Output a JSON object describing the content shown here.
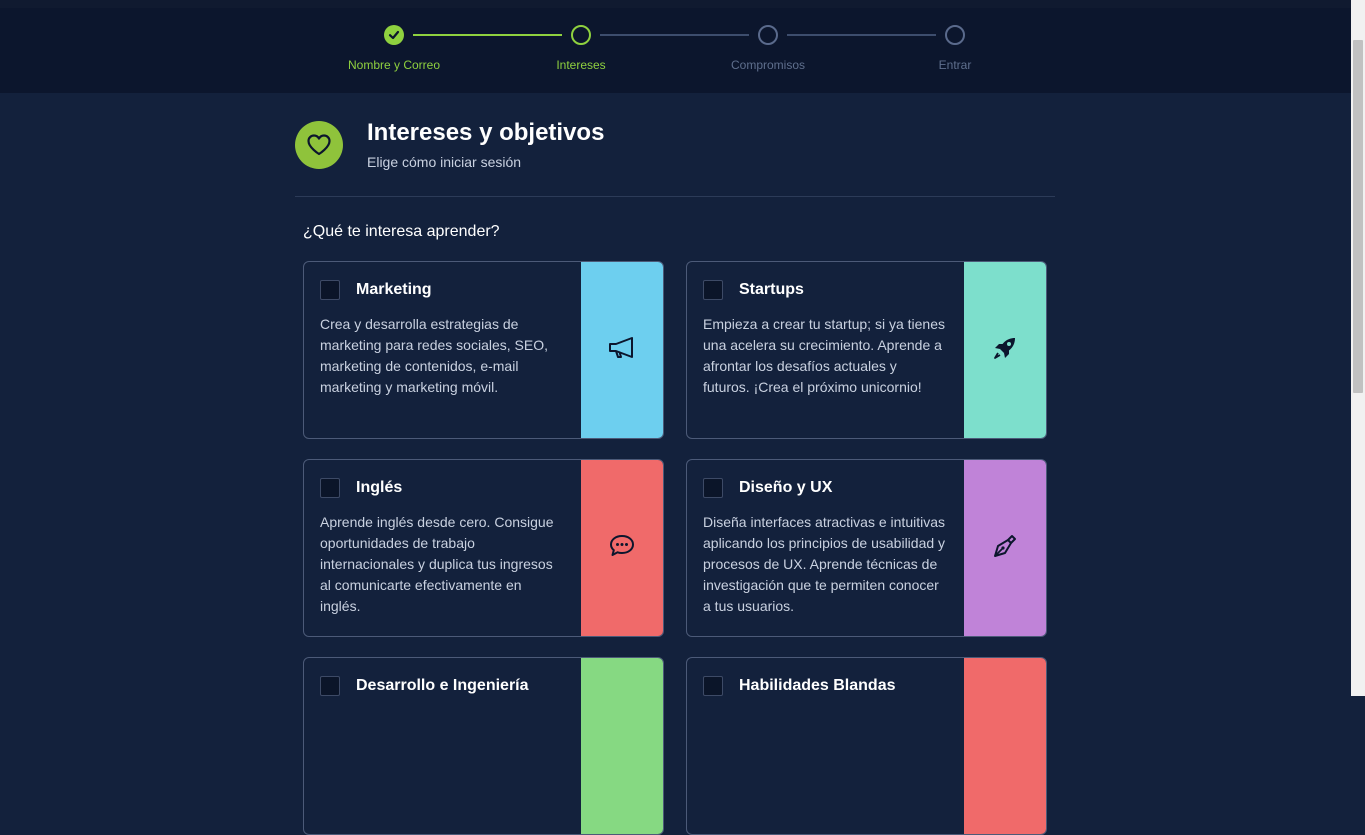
{
  "stepper": {
    "steps": [
      {
        "label": "Nombre y Correo",
        "state": "done"
      },
      {
        "label": "Intereses",
        "state": "current"
      },
      {
        "label": "Compromisos",
        "state": "todo"
      },
      {
        "label": "Entrar",
        "state": "todo"
      }
    ]
  },
  "header": {
    "title": "Intereses y objetivos",
    "subtitle": "Elige cómo iniciar sesión",
    "icon": "heart-icon"
  },
  "question": "¿Qué te interesa aprender?",
  "cards": [
    {
      "title": "Marketing",
      "description": "Crea y desarrolla estrategias de marketing para redes sociales, SEO, marketing de contenidos, e-mail marketing y marketing móvil.",
      "icon": "megaphone-icon",
      "color": "#6dcfef",
      "checked": false
    },
    {
      "title": "Startups",
      "description": "Empieza a crear tu startup; si ya tienes una acelera su crecimiento. Aprende a afrontar los desafíos actuales y futuros. ¡Crea el próximo unicornio!",
      "icon": "rocket-icon",
      "color": "#7ddfcc",
      "checked": false
    },
    {
      "title": "Inglés",
      "description": "Aprende inglés desde cero. Consigue oportunidades de trabajo internacionales y duplica tus ingresos al comunicarte efectivamente en inglés.",
      "icon": "chat-bubble-icon",
      "color": "#f06a6a",
      "checked": false
    },
    {
      "title": "Diseño y UX",
      "description": "Diseña interfaces atractivas e intuitivas aplicando los principios de usabilidad y procesos de UX. Aprende técnicas de investigación que te permiten conocer a tus usuarios.",
      "icon": "pen-nib-icon",
      "color": "#c083d8",
      "checked": false
    },
    {
      "title": "Desarrollo e Ingeniería",
      "description": "",
      "icon": "",
      "color": "#86d982",
      "checked": false
    },
    {
      "title": "Habilidades Blandas",
      "description": "",
      "icon": "",
      "color": "#f06a6a",
      "checked": false
    }
  ],
  "colors": {
    "accent": "#8fd13f",
    "background": "#13213c",
    "stepper_background": "#0c162d"
  }
}
